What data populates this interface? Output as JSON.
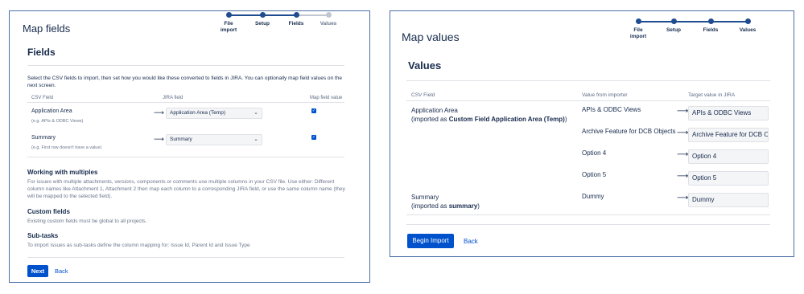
{
  "left": {
    "title": "Map fields",
    "steps": [
      {
        "label": "File\nimport",
        "state": "done"
      },
      {
        "label": "Setup",
        "state": "done"
      },
      {
        "label": "Fields",
        "state": "current"
      },
      {
        "label": "Values",
        "state": "todo"
      }
    ],
    "section_title": "Fields",
    "description": "Select the CSV fields to import, then set how you would like these converted to fields in JIRA. You can optionally map field values on the next screen.",
    "columns": {
      "csv": "CSV Field",
      "jira": "JIRA field",
      "map": "Map field value"
    },
    "rows": [
      {
        "label": "Application Area",
        "hint": "(e.g. APIs & ODBC Views)",
        "jira_field": "Application Area (Temp)",
        "map_value": true
      },
      {
        "label": "Summary",
        "hint": "(e.g. First row doesn't have a value)",
        "jira_field": "Summary",
        "map_value": true
      }
    ],
    "working_multiples": {
      "title": "Working with multiples",
      "text": "For issues with multiple attachments, versions, components or comments use multiple columns in your CSV file. Use either: Different column names like Attachment 1, Attachment 2 then map each column to a corresponding JIRA field, or use the same column name (they will be mapped to the selected field)."
    },
    "custom_fields": {
      "title": "Custom fields",
      "text": "Existing custom fields must be global to all projects."
    },
    "sub_tasks": {
      "title": "Sub-tasks",
      "text": "To import issues as sub-tasks define the column mapping for: Issue Id, Parent Id and Issue Type"
    },
    "next_label": "Next",
    "back_label": "Back"
  },
  "right": {
    "title": "Map values",
    "steps": [
      {
        "label": "File\nimport",
        "state": "done"
      },
      {
        "label": "Setup",
        "state": "done"
      },
      {
        "label": "Fields",
        "state": "done"
      },
      {
        "label": "Values",
        "state": "current"
      }
    ],
    "section_title": "Values",
    "columns": {
      "csv": "CSV Field",
      "importer": "Value from importer",
      "target": "Target value in JIRA"
    },
    "field1": {
      "name": "Application Area",
      "imported_prefix": "(imported as ",
      "imported_name": "Custom Field Application Area (Temp)",
      "imported_suffix": ")"
    },
    "field2": {
      "name": "Summary",
      "imported_prefix": "(imported as ",
      "imported_name": "summary",
      "imported_suffix": ")"
    },
    "values": [
      {
        "from": "APIs & ODBC Views",
        "to": "APIs & ODBC Views"
      },
      {
        "from": "Archive Feature for DCB Objects",
        "to": "Archive Feature for DCB Objects"
      },
      {
        "from": "Option 4",
        "to": "Option 4"
      },
      {
        "from": "Option 5",
        "to": "Option 5"
      },
      {
        "from": "Dummy",
        "to": "Dummy"
      }
    ],
    "begin_label": "Begin Import",
    "back_label": "Back"
  },
  "icons": {
    "arrow": "arrow-right-icon",
    "chevron": "chevron-down-icon",
    "check": "checkmark-icon"
  },
  "colors": {
    "primary": "#0052cc",
    "stepper": "#1f4b8f",
    "panel_border": "#4a6fa5"
  }
}
